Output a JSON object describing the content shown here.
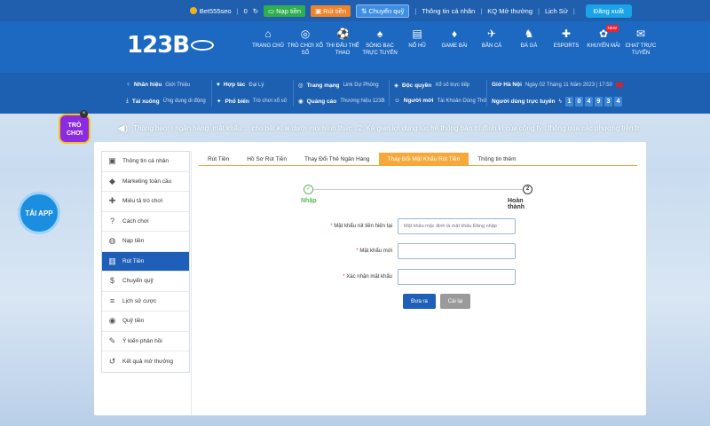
{
  "topbar": {
    "username": "Bet555seo",
    "balance": "0",
    "deposit": "Nạp tiền",
    "withdraw": "Rút tiền",
    "transfer": "Chuyển quỹ",
    "profile": "Thông tin cá nhân",
    "results": "KQ Mở thưởng",
    "history": "Lịch Sử",
    "logout": "Đăng xuất"
  },
  "logo": {
    "text": "123B"
  },
  "nav": [
    {
      "label": "TRANG CHỦ",
      "icon": "home-icon"
    },
    {
      "label": "TRÒ CHƠI XỔ SỐ",
      "icon": "lottery-icon"
    },
    {
      "label": "THI ĐẤU THỂ THAO",
      "icon": "soccer-icon"
    },
    {
      "label": "SÒNG BẠC TRỰC TUYẾN",
      "icon": "casino-icon"
    },
    {
      "label": "NỔ HŨ",
      "icon": "slot-icon"
    },
    {
      "label": "GAME BÀI",
      "icon": "cards-icon"
    },
    {
      "label": "BẮN CÁ",
      "icon": "fish-icon"
    },
    {
      "label": "ĐÁ GÀ",
      "icon": "rooster-icon"
    },
    {
      "label": "ESPORTS",
      "icon": "gamepad-icon"
    },
    {
      "label": "KHUYẾN MÃI",
      "icon": "gift-icon",
      "badge": "NEW"
    },
    {
      "label": "CHAT TRỰC TUYẾN",
      "icon": "chat-icon"
    }
  ],
  "info": {
    "brand_k": "Nhãn hiệu",
    "brand_v": "Giới Thiệu",
    "coop_k": "Hợp tác",
    "coop_v": "Đại Lý",
    "network_k": "Trang mạng",
    "network_v": "Link Dự Phòng",
    "auth_k": "Độc quyền",
    "auth_v": "Xổ số trực tiếp",
    "download_k": "Tải xuống",
    "download_v": "Ứng dụng di động",
    "popular_k": "Phổ biến",
    "popular_v": "Trò chơi xổ số",
    "ads_k": "Quảng cáo",
    "ads_v": "Thương hiệu 123B",
    "new_k": "Người mới",
    "new_v": "Tài Khoản Dùng Thử",
    "time_k": "Giờ Hà Nội",
    "time_v": "Ngày 02 Tháng 11 Năm 2023 | 17:50",
    "online_k": "Người dùng trực tuyến",
    "online_digits": [
      "1",
      "0",
      "4",
      "9",
      "3",
      "4"
    ]
  },
  "marquee": {
    "text": "Thông báo: ı ngân hàng, mật khẩu.... cho bất kì ai dưới mọi hình thức ,    2. Kẻ gian lợi dụng lúc hệ thống bảo trì đình kì của công ty , thông qua các phương tiện tr"
  },
  "floating": {
    "play_badge": "TRÒ CHƠI",
    "close": "×",
    "app": "TẢI APP"
  },
  "sidebar": [
    {
      "label": "Thông tin cá nhân",
      "icon": "id-card-icon",
      "active": false
    },
    {
      "label": "Marketing toàn cầu",
      "icon": "diamond-icon",
      "active": false
    },
    {
      "label": "Miêu tả trò chơi",
      "icon": "gamepad-icon",
      "active": false
    },
    {
      "label": "Cách chơi",
      "icon": "help-icon",
      "active": false
    },
    {
      "label": "Nạp tiền",
      "icon": "piggy-bank-icon",
      "active": false
    },
    {
      "label": "Rút Tiền",
      "icon": "bank-icon",
      "active": true
    },
    {
      "label": "Chuyển quỹ",
      "icon": "dollar-icon",
      "active": false
    },
    {
      "label": "Lịch sử cược",
      "icon": "list-icon",
      "active": false
    },
    {
      "label": "Quỹ tiền",
      "icon": "coins-icon",
      "active": false
    },
    {
      "label": "Ý kiến phản hồi",
      "icon": "feedback-icon",
      "active": false
    },
    {
      "label": "Kết quả mở thưởng",
      "icon": "history-icon",
      "active": false
    }
  ],
  "tabs": [
    {
      "label": "Rút Tiền",
      "active": false
    },
    {
      "label": "Hồ Sơ Rút Tiền",
      "active": false
    },
    {
      "label": "Thay Đổi Thẻ Ngân Hàng",
      "active": false
    },
    {
      "label": "Thay Đổi Mật Khẩu Rút Tiền",
      "active": true
    },
    {
      "label": "Thông tin thêm",
      "active": false
    }
  ],
  "steps": {
    "step1_mark": "✓",
    "step1_label": "Nhập",
    "step2_mark": "2",
    "step2_label": "Hoàn thành"
  },
  "form": {
    "current_label": "Mật khẩu rút tiền hiện tại",
    "current_placeholder": "Mật khẩu mặc định là mật khẩu Đăng nhập",
    "new_label": "Mật khẩu mới",
    "confirm_label": "Xác nhận mật khẩu",
    "required_mark": "*",
    "submit": "Đưa ra",
    "reset": "Cài lại"
  },
  "colors": {
    "topbar": "#1f5fae",
    "header": "#1d69c2",
    "active_blue": "#1f5fb8",
    "tab_orange": "#f7a83a",
    "success_green": "#5bb85b"
  }
}
